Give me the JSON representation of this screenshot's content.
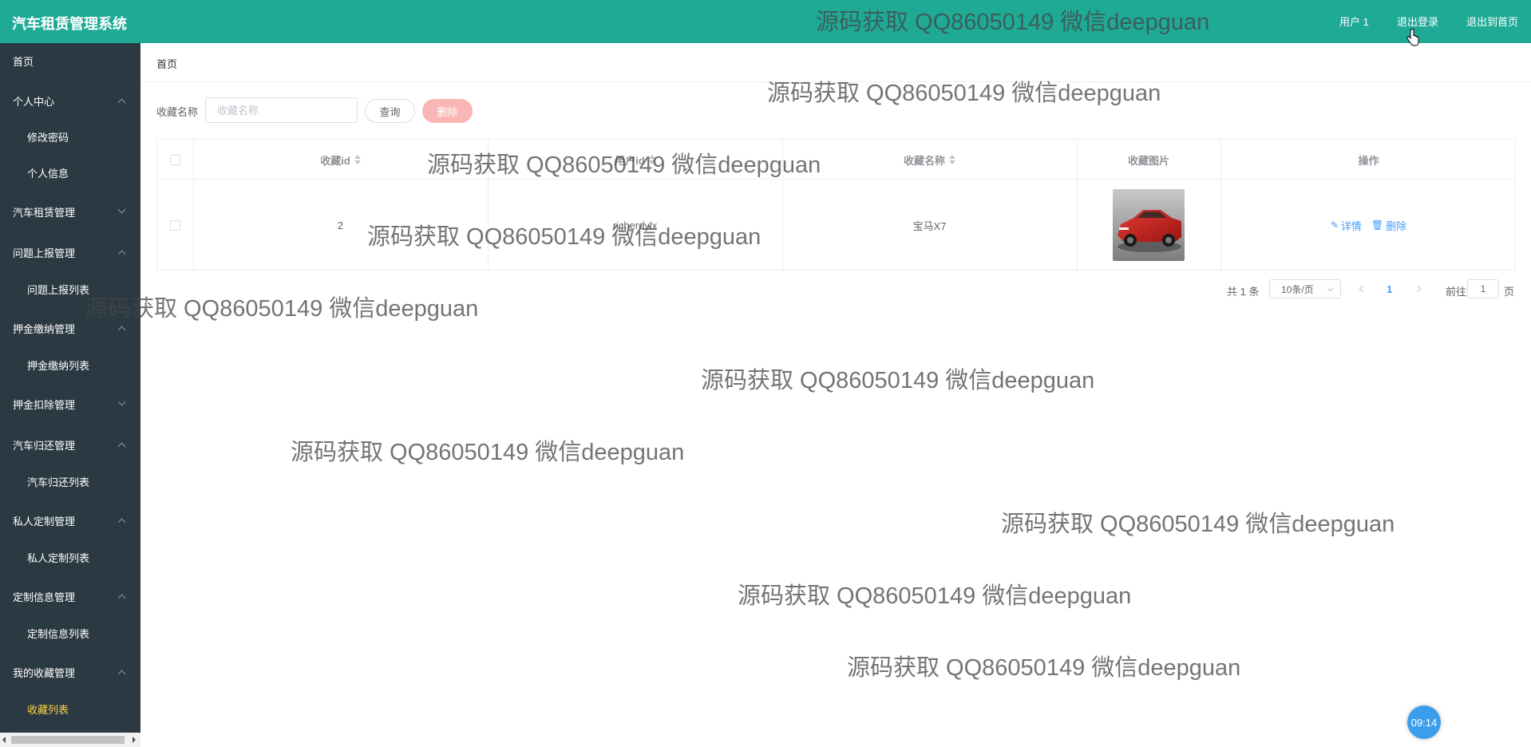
{
  "header": {
    "app_title": "汽车租赁管理系统",
    "user": "用户 1",
    "logout": "退出登录",
    "exit_home": "退出到首页",
    "bg_color": "#1faa96"
  },
  "sidebar": {
    "bg_color": "#2b3a42",
    "items": [
      {
        "label": "首页"
      },
      {
        "label": "个人中心"
      },
      {
        "label": "修改密码"
      },
      {
        "label": "个人信息"
      },
      {
        "label": "汽车租赁管理"
      },
      {
        "label": "问题上报管理"
      },
      {
        "label": "问题上报列表"
      },
      {
        "label": "押金缴纳管理"
      },
      {
        "label": "押金缴纳列表"
      },
      {
        "label": "押金扣除管理"
      },
      {
        "label": "汽车归还管理"
      },
      {
        "label": "汽车归还列表"
      },
      {
        "label": "私人定制管理"
      },
      {
        "label": "私人定制列表"
      },
      {
        "label": "定制信息管理"
      },
      {
        "label": "定制信息列表"
      },
      {
        "label": "我的收藏管理"
      },
      {
        "label": "收藏列表"
      }
    ],
    "active_label": "收藏列表"
  },
  "breadcrumb": "首页",
  "search": {
    "label": "收藏名称",
    "placeholder": "收藏名称",
    "value": "",
    "query_button": "查询",
    "delete_button": "删除"
  },
  "table": {
    "columns": [
      "收藏id",
      "用户id",
      "收藏名称",
      "收藏图片",
      "操作"
    ],
    "rows": [
      {
        "id": "2",
        "user": "richerdylx",
        "name": "宝马X7",
        "image": "car-red",
        "actions": [
          "详情",
          "删除"
        ]
      }
    ]
  },
  "pagination": {
    "total": "共 1 条",
    "page_size": "10条/页",
    "current": "1",
    "goto_label": "前往",
    "goto_value": "1",
    "page_unit": "页"
  },
  "clock": "09:14",
  "watermark": "源码获取 QQ86050149 微信deepguan"
}
